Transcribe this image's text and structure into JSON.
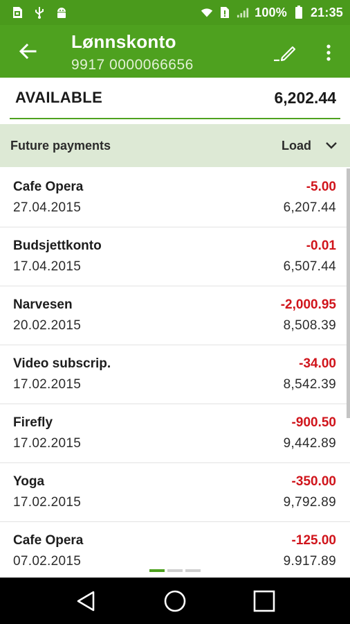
{
  "status_bar": {
    "battery_text": "100%",
    "time": "21:35",
    "icons": [
      "sim-icon",
      "usb-icon",
      "android-icon",
      "wifi-icon",
      "sim-alert-icon",
      "signal-icon",
      "battery-icon"
    ]
  },
  "app_bar": {
    "title": "Lønnskonto",
    "subtitle": "9917 0000066656",
    "back_icon": "arrow-back-icon",
    "edit_icon": "pencil-icon",
    "more_icon": "more-vert-icon"
  },
  "available": {
    "label": "AVAILABLE",
    "value": "6,202.44"
  },
  "future_payments": {
    "title": "Future payments",
    "load_label": "Load",
    "chevron_icon": "chevron-down-icon"
  },
  "transactions": [
    {
      "name": "Cafe Opera",
      "date": "27.04.2015",
      "amount": "-5.00",
      "balance": "6,207.44"
    },
    {
      "name": "Budsjettkonto",
      "date": "17.04.2015",
      "amount": "-0.01",
      "balance": "6,507.44"
    },
    {
      "name": "Narvesen",
      "date": "20.02.2015",
      "amount": "-2,000.95",
      "balance": "8,508.39"
    },
    {
      "name": "Video subscrip.",
      "date": "17.02.2015",
      "amount": "-34.00",
      "balance": "8,542.39"
    },
    {
      "name": "Firefly",
      "date": "17.02.2015",
      "amount": "-900.50",
      "balance": "9,442.89"
    },
    {
      "name": "Yoga",
      "date": "17.02.2015",
      "amount": "-350.00",
      "balance": "9,792.89"
    },
    {
      "name": "Cafe Opera",
      "date": "07.02.2015",
      "amount": "-125.00",
      "balance": "9,917.89"
    }
  ],
  "pager": {
    "pages": 3,
    "active": 1
  },
  "colors": {
    "brand_green": "#4ea11f",
    "status_green": "#4a9a1c",
    "header_tint": "#dde9d5",
    "negative_red": "#d0141b"
  },
  "nav_bar": {
    "back_icon": "nav-back-icon",
    "home_icon": "nav-home-icon",
    "recents_icon": "nav-recents-icon"
  }
}
